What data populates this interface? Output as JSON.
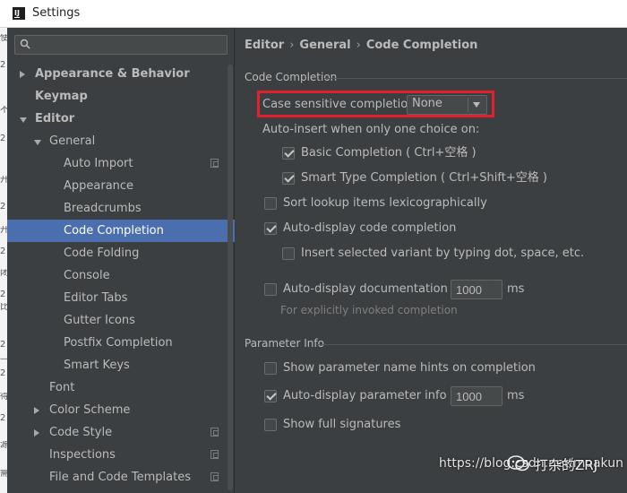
{
  "window": {
    "title": "Settings",
    "app_icon": "IJ"
  },
  "background_glyphs": [
    "使",
    "2",
    "不",
    "2",
    "开",
    "2",
    "开",
    "2",
    "闭",
    "2",
    "比",
    "2",
    "—",
    "2",
    "得",
    "2",
    "源",
    "需"
  ],
  "search": {
    "placeholder": "",
    "icon": "search-icon"
  },
  "sidebar": {
    "items": [
      {
        "label": "Appearance & Behavior",
        "arrow": "right",
        "bold": true
      },
      {
        "label": "Keymap",
        "bold": true
      },
      {
        "label": "Editor",
        "arrow": "down",
        "bold": true
      },
      {
        "label": "General",
        "arrow": "down"
      },
      {
        "label": "Auto Import",
        "copy": true
      },
      {
        "label": "Appearance"
      },
      {
        "label": "Breadcrumbs"
      },
      {
        "label": "Code Completion",
        "selected": true
      },
      {
        "label": "Code Folding"
      },
      {
        "label": "Console"
      },
      {
        "label": "Editor Tabs"
      },
      {
        "label": "Gutter Icons"
      },
      {
        "label": "Postfix Completion"
      },
      {
        "label": "Smart Keys"
      },
      {
        "label": "Font"
      },
      {
        "label": "Color Scheme",
        "arrow": "right"
      },
      {
        "label": "Code Style",
        "arrow": "right",
        "copy": true
      },
      {
        "label": "Inspections",
        "copy": true
      },
      {
        "label": "File and Code Templates",
        "copy": true
      }
    ]
  },
  "breadcrumb": [
    "Editor",
    "General",
    "Code Completion"
  ],
  "code_completion": {
    "group_title": "Code Completion",
    "case_sensitive_label": "Case sensitive completion:",
    "case_sensitive_value": "None",
    "auto_insert_label": "Auto-insert when only one choice on:",
    "basic_completion": {
      "label": "Basic Completion ( Ctrl+空格 )",
      "checked": true
    },
    "smart_type_completion": {
      "label": "Smart Type Completion ( Ctrl+Shift+空格 )",
      "checked": true
    },
    "sort_lookup": {
      "label": "Sort lookup items lexicographically",
      "checked": false
    },
    "auto_display_completion": {
      "label": "Auto-display code completion",
      "checked": true
    },
    "insert_selected_variant": {
      "label": "Insert selected variant by typing dot, space, etc.",
      "checked": false
    },
    "auto_display_documentation": {
      "label": "Auto-display documentation in",
      "checked": false,
      "value": "1000",
      "unit": "ms"
    },
    "doc_hint": "For explicitly invoked completion"
  },
  "parameter_info": {
    "group_title": "Parameter Info",
    "show_name_hints": {
      "label": "Show parameter name hints on completion",
      "checked": false
    },
    "auto_display_param_info": {
      "label": "Auto-display parameter info in",
      "checked": true,
      "value": "1000",
      "unit": "ms"
    },
    "show_full_signatures": {
      "label": "Show full signatures",
      "checked": false
    }
  },
  "watermark": {
    "url": "https://blog.csdn.net/moakun",
    "brand": "打杂的ZRJ"
  },
  "colors": {
    "background": "#3c3f41",
    "selection": "#4b6eaf",
    "highlight_border": "#e3202b",
    "text": "#bbbbbb"
  }
}
